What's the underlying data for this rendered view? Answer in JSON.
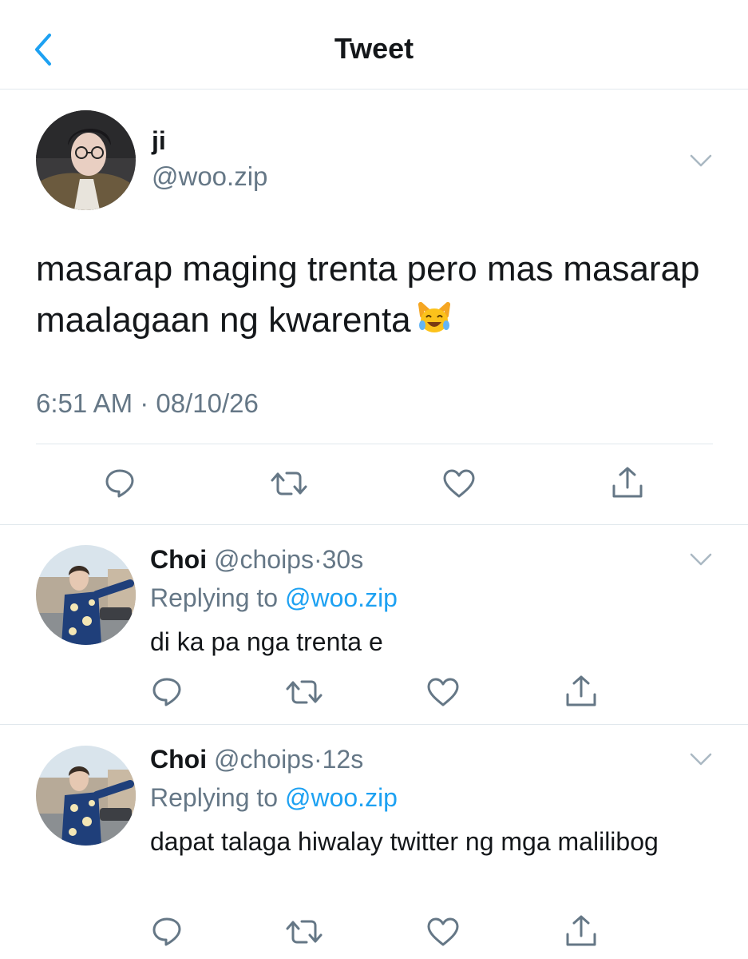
{
  "header": {
    "title": "Tweet",
    "back_icon": "chevron-left-icon"
  },
  "colors": {
    "accent": "#1da1f2",
    "secondary_text": "#657786",
    "divider": "#e1e8ed",
    "icon": "#657786"
  },
  "main_tweet": {
    "name": "ji",
    "handle": "@woo.zip",
    "text": "masarap maging trenta pero mas masarap maalagaan ng kwarenta",
    "emoji": "😹",
    "time": "6:51 AM",
    "separator": "·",
    "date": "08/10/26",
    "actions": [
      "reply-icon",
      "retweet-icon",
      "like-icon",
      "share-icon"
    ]
  },
  "replies": [
    {
      "name": "Choi",
      "handle": "@choips",
      "separator": "·",
      "time": "30s",
      "replying_label": "Replying to",
      "replying_to": "@woo.zip",
      "text": "di ka pa nga trenta e"
    },
    {
      "name": "Choi",
      "handle": "@choips",
      "separator": "·",
      "time": "12s",
      "replying_label": "Replying to",
      "replying_to": "@woo.zip",
      "text": "dapat talaga hiwalay twitter ng mga malilibog"
    }
  ]
}
